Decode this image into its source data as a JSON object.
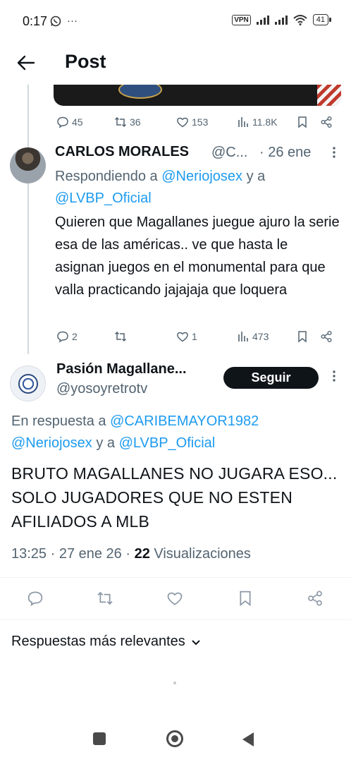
{
  "status_bar": {
    "time": "0:17",
    "more": "···",
    "vpn": "VPN",
    "battery": "41"
  },
  "header": {
    "title": "Post"
  },
  "prev_actions": {
    "replies": "45",
    "reposts": "36",
    "likes": "153",
    "views": "11.8K"
  },
  "reply": {
    "name": "CARLOS MORALES",
    "handle": "@C...",
    "date": "· 26 ene",
    "replying_prefix": "Respondiendo a ",
    "mention1": "@Neriojosex",
    "replying_join": " y a ",
    "mention2": "@LVBP_Oficial",
    "text": "Quieren que Magallanes juegue ajuro la serie esa de las américas.. ve que hasta le asignan juegos en el monumental para que valla practicando jajajaja que loquera",
    "actions": {
      "replies": "2",
      "reposts": "",
      "likes": "1",
      "views": "473"
    }
  },
  "main": {
    "name": "Pasión Magallane...",
    "handle": "@yosoyretrotv",
    "follow_label": "Seguir",
    "reply_prefix": "En respuesta a ",
    "mention1": "@CARIBEMAYOR1982",
    "mention2": "@Neriojosex",
    "reply_join": " y a ",
    "mention3": "@LVBP_Oficial",
    "text": "BRUTO MAGALLANES NO JUGARA ESO... SOLO JUGADORES QUE NO ESTEN AFILIADOS A MLB",
    "time": "13:25 · 27 ene 26 · ",
    "views_count": "22",
    "views_label": " Visualizaciones"
  },
  "replies_sort": {
    "label": "Respuestas más relevantes"
  },
  "icons": [
    "back-arrow-icon",
    "comment-icon",
    "repost-icon",
    "heart-icon",
    "views-icon",
    "bookmark-icon",
    "share-icon",
    "more-icon",
    "chevron-down-icon"
  ],
  "colors": {
    "link": "#1d9bf0",
    "muted": "#536471",
    "text": "#0f1419"
  }
}
